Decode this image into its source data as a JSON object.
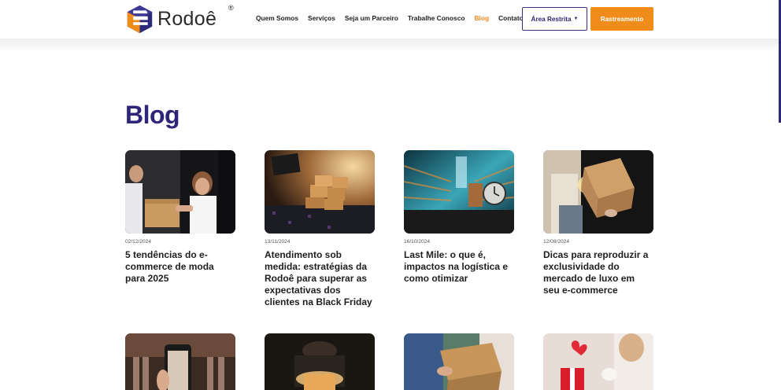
{
  "brand": {
    "name": "Rodoê",
    "reg": "®"
  },
  "nav": {
    "items": [
      {
        "label": "Quem Somos",
        "active": false
      },
      {
        "label": "Serviços",
        "active": false
      },
      {
        "label": "Seja um Parceiro",
        "active": false
      },
      {
        "label": "Trabalhe Conosco",
        "active": false
      },
      {
        "label": "Blog",
        "active": true
      },
      {
        "label": "Contato",
        "active": false
      }
    ],
    "area_restrita": "Área Restrita",
    "rastreamento": "Rastreamento"
  },
  "page": {
    "title": "Blog"
  },
  "posts": [
    {
      "date": "02/12/2024",
      "title": "5 tendências do e-commerce de moda para 2025",
      "image": "delivery-handoff-photo"
    },
    {
      "date": "13/11/2024",
      "title": "Atendimento sob medida: estratégias da Rodoê para superar as expectativas dos clientes na Black Friday",
      "image": "black-friday-boxes-photo"
    },
    {
      "date": "16/10/2024",
      "title": "Last Mile: o que é, impactos na logística e como otimizar",
      "image": "warehouse-clock-photo"
    },
    {
      "date": "12/08/2024",
      "title": "Dicas para reproduzir a exclusividade do mercado de luxo em seu e-commerce",
      "image": "glowing-box-photo"
    }
  ],
  "posts_row2": [
    {
      "image": "phone-shopping-photo"
    },
    {
      "image": "gift-box-glow-photo"
    },
    {
      "image": "package-handoff-photo"
    },
    {
      "image": "gift-unboxing-photo"
    }
  ],
  "colors": {
    "brand_purple": "#2e2578",
    "accent_orange": "#f08c1a"
  }
}
